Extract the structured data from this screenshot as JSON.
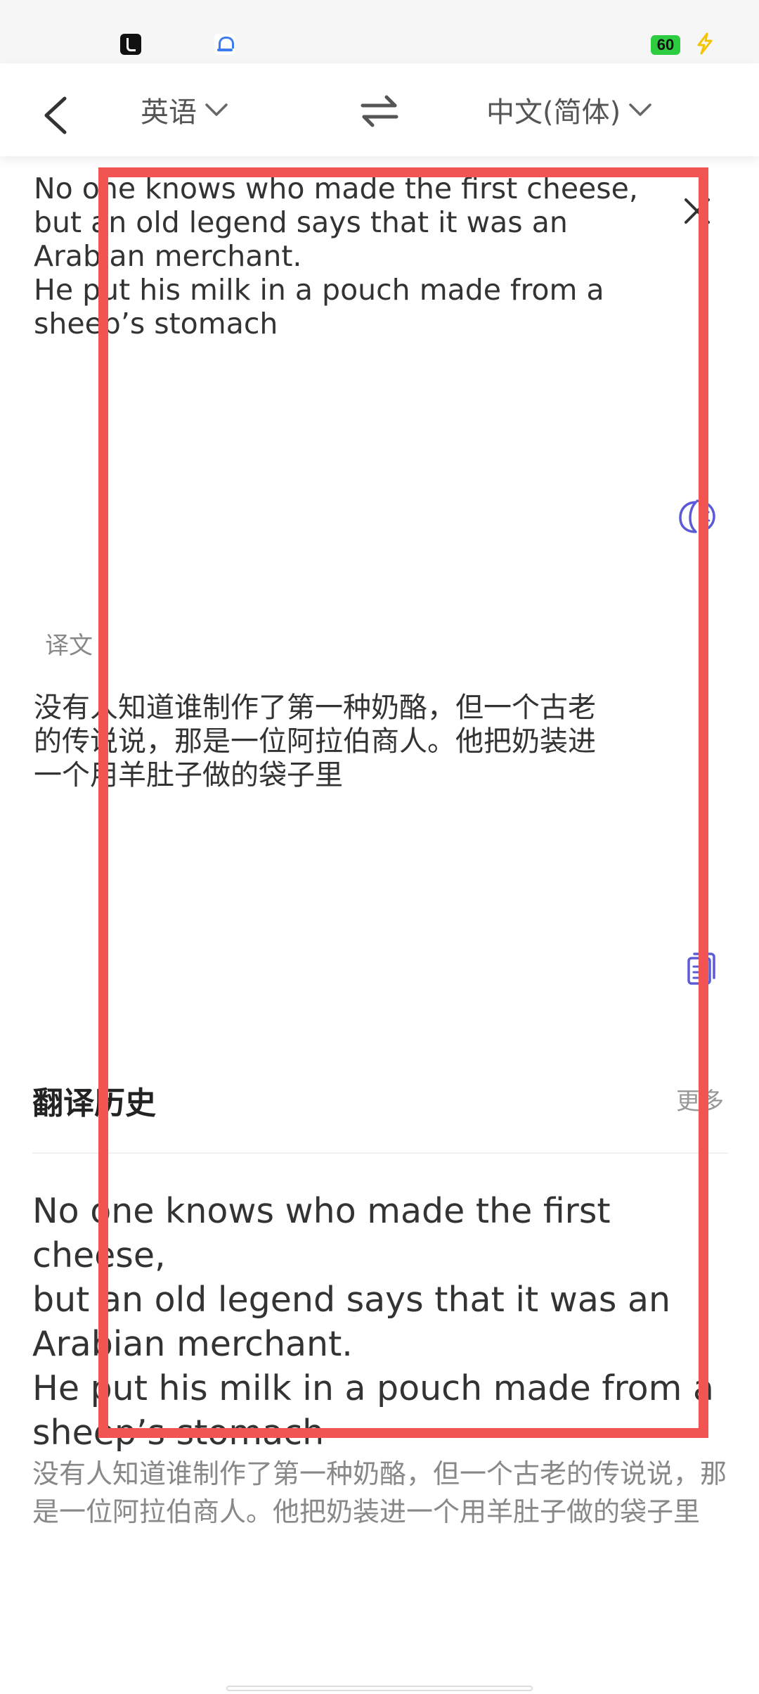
{
  "status_bar": {
    "battery_level": "60",
    "icons": [
      "tiktok-icon",
      "cloud-app-icon",
      "battery-icon",
      "charging-icon"
    ]
  },
  "header": {
    "source_language": "英语",
    "target_language": "中文(简体)"
  },
  "source": {
    "text": "No one knows who made the first cheese,\nbut an old legend says that it was an\nArabian merchant.\nHe put his milk in a pouch made from a\nsheep’s stomach"
  },
  "translation": {
    "label": "译文",
    "text": "没有人知道谁制作了第一种奶酪，但一个古老的传说说，那是一位阿拉伯商人。他把奶装进一个用羊肚子做的袋子里"
  },
  "history": {
    "title": "翻译历史",
    "more_label": "更多",
    "items": [
      {
        "source": "No one knows who made the first cheese,\nbut an old legend says that it was an\nArabian merchant.\nHe put his milk in a pouch made from a\nsheep’s stomach",
        "target": "没有人知道谁制作了第一种奶酪，但一个古老的传说说，那是一位阿拉伯商人。他把奶装进一个用羊肚子做的袋子里"
      }
    ]
  },
  "colors": {
    "accent": "#5b5bd6",
    "highlight_border": "#f25452",
    "battery": "#2ecc40",
    "muted_text": "#888888"
  }
}
